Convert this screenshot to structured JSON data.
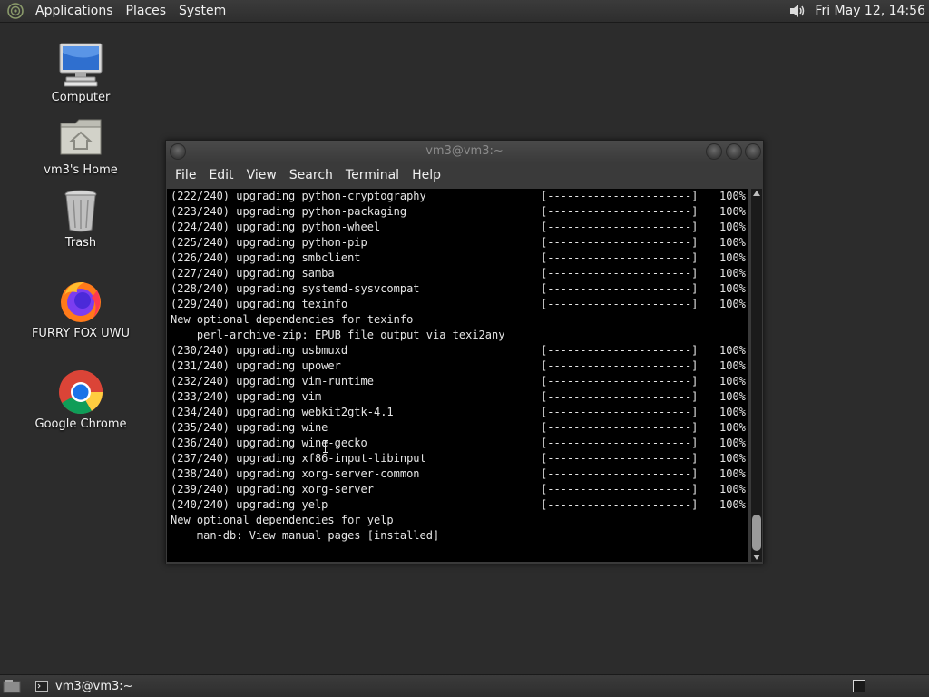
{
  "top_panel": {
    "menus": [
      "Applications",
      "Places",
      "System"
    ],
    "clock": "Fri May 12, 14:56"
  },
  "desktop_icons": [
    {
      "label": "Computer",
      "icon": "computer-icon"
    },
    {
      "label": "vm3's Home",
      "icon": "home-folder-icon"
    },
    {
      "label": "Trash",
      "icon": "trash-icon"
    },
    {
      "label": "FURRY FOX UWU",
      "icon": "firefox-icon"
    },
    {
      "label": "Google Chrome",
      "icon": "chrome-icon"
    }
  ],
  "terminal": {
    "title": "vm3@vm3:~",
    "menu": [
      "File",
      "Edit",
      "View",
      "Search",
      "Terminal",
      "Help"
    ],
    "progress_bar": "[----------------------]",
    "lines": [
      {
        "text": "(222/240) upgrading python-cryptography",
        "pct": "100%"
      },
      {
        "text": "(223/240) upgrading python-packaging",
        "pct": "100%"
      },
      {
        "text": "(224/240) upgrading python-wheel",
        "pct": "100%"
      },
      {
        "text": "(225/240) upgrading python-pip",
        "pct": "100%"
      },
      {
        "text": "(226/240) upgrading smbclient",
        "pct": "100%"
      },
      {
        "text": "(227/240) upgrading samba",
        "pct": "100%"
      },
      {
        "text": "(228/240) upgrading systemd-sysvcompat",
        "pct": "100%"
      },
      {
        "text": "(229/240) upgrading texinfo",
        "pct": "100%"
      },
      {
        "text": "New optional dependencies for texinfo",
        "pct": ""
      },
      {
        "text": "    perl-archive-zip: EPUB file output via texi2any",
        "pct": ""
      },
      {
        "text": "(230/240) upgrading usbmuxd",
        "pct": "100%"
      },
      {
        "text": "(231/240) upgrading upower",
        "pct": "100%"
      },
      {
        "text": "(232/240) upgrading vim-runtime",
        "pct": "100%"
      },
      {
        "text": "(233/240) upgrading vim",
        "pct": "100%"
      },
      {
        "text": "(234/240) upgrading webkit2gtk-4.1",
        "pct": "100%"
      },
      {
        "text": "(235/240) upgrading wine",
        "pct": "100%"
      },
      {
        "text": "(236/240) upgrading wine-gecko",
        "pct": "100%"
      },
      {
        "text": "(237/240) upgrading xf86-input-libinput",
        "pct": "100%"
      },
      {
        "text": "(238/240) upgrading xorg-server-common",
        "pct": "100%"
      },
      {
        "text": "(239/240) upgrading xorg-server",
        "pct": "100%"
      },
      {
        "text": "(240/240) upgrading yelp",
        "pct": "100%"
      },
      {
        "text": "New optional dependencies for yelp",
        "pct": ""
      },
      {
        "text": "    man-db: View manual pages [installed]",
        "pct": ""
      }
    ]
  },
  "bottom_panel": {
    "task_label": "vm3@vm3:~"
  }
}
